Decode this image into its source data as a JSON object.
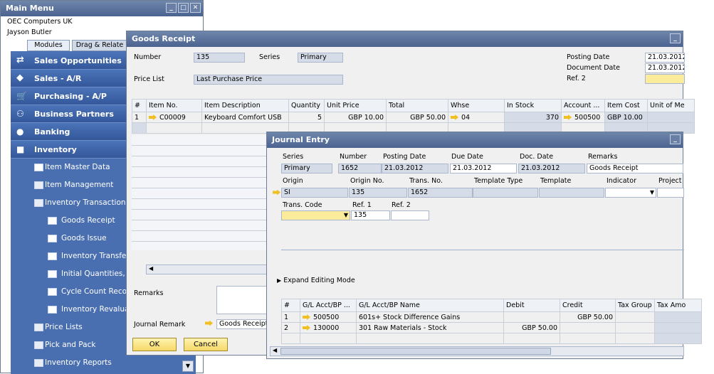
{
  "main_menu": {
    "title": "Main Menu",
    "company": "OEC Computers UK",
    "user": "Jayson Butler",
    "tabs": [
      "Modules",
      "Drag & Relate"
    ],
    "modules": [
      "Sales Opportunities",
      "Sales - A/R",
      "Purchasing - A/P",
      "Business Partners",
      "Banking",
      "Inventory"
    ],
    "inventory_items": [
      "Item Master Data",
      "Item Management",
      "Inventory Transactions",
      "Goods Receipt",
      "Goods Issue",
      "Inventory Transfer",
      "Initial Quantities, In",
      "Cycle Count Recon",
      "Inventory Revalua",
      "Price Lists",
      "Pick and Pack",
      "Inventory Reports"
    ]
  },
  "goods_receipt": {
    "title": "Goods Receipt",
    "number_label": "Number",
    "number": "135",
    "series_label": "Series",
    "series": "Primary",
    "price_list_label": "Price List",
    "price_list": "Last Purchase Price",
    "posting_date_label": "Posting Date",
    "posting_date": "21.03.2012",
    "document_date_label": "Document Date",
    "document_date": "21.03.2012",
    "ref2_label": "Ref. 2",
    "columns": [
      "#",
      "Item No.",
      "Item Description",
      "Quantity",
      "Unit Price",
      "Total",
      "Whse",
      "In Stock",
      "Account ...",
      "Item Cost",
      "Unit of Me"
    ],
    "rows": [
      [
        "1",
        "C00009",
        "Keyboard Comfort USB",
        "5",
        "GBP 10.00",
        "GBP 50.00",
        "04",
        "370",
        "500500",
        "GBP 10.00",
        ""
      ]
    ],
    "remarks_label": "Remarks",
    "journal_remark_label": "Journal Remark",
    "journal_remark": "Goods Receipt",
    "ok": "OK",
    "cancel": "Cancel"
  },
  "journal_entry": {
    "title": "Journal Entry",
    "row1_labels": [
      "Series",
      "Number",
      "Posting Date",
      "Due Date",
      "Doc. Date",
      "Remarks"
    ],
    "row1_values": [
      "Primary",
      "1652",
      "21.03.2012",
      "21.03.2012",
      "21.03.2012",
      "Goods Receipt"
    ],
    "row2_labels": [
      "Origin",
      "Origin No.",
      "Trans. No.",
      "Template Type",
      "Template",
      "Indicator",
      "Project"
    ],
    "row2_values": [
      "SI",
      "135",
      "1652",
      "",
      "",
      "",
      ""
    ],
    "trans_code_label": "Trans. Code",
    "ref1_label": "Ref. 1",
    "ref1": "135",
    "ref2_label": "Ref. 2",
    "ref2": "",
    "expand": "Expand Editing Mode",
    "columns": [
      "#",
      "G/L Acct/BP ...",
      "G/L Acct/BP Name",
      "Debit",
      "Credit",
      "Tax Group",
      "Tax Amo"
    ],
    "rows": [
      [
        "1",
        "500500",
        "601s+ Stock Difference Gains",
        "",
        "GBP 50.00",
        "",
        ""
      ],
      [
        "2",
        "130000",
        "301 Raw Materials - Stock",
        "GBP 50.00",
        "",
        "",
        ""
      ]
    ]
  },
  "colors": {
    "title_bar": "#56709b",
    "menu_blue": "#3a5fa3",
    "field_yellow": "#fbeb9a",
    "button_yellow": "#f5d868"
  }
}
